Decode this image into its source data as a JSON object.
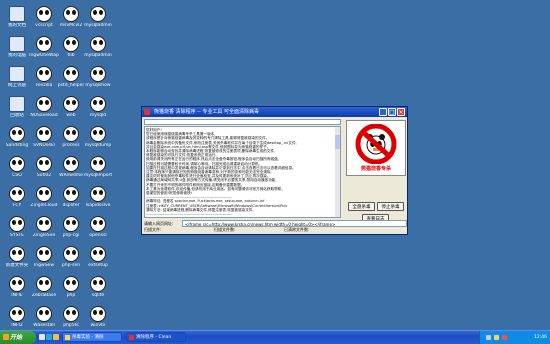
{
  "desktop": {
    "icons": [
      {
        "label": "我的文档",
        "col": 0,
        "row": 0,
        "type": "sys"
      },
      {
        "label": "我的电脑",
        "col": 0,
        "row": 1,
        "type": "sys"
      },
      {
        "label": "网上邻居",
        "col": 0,
        "row": 2,
        "type": "sys"
      },
      {
        "label": "回收站",
        "col": 0,
        "row": 3,
        "type": "sys"
      },
      {
        "label": "Sandsting",
        "col": 0,
        "row": 4,
        "type": "panda"
      },
      {
        "label": "CSO",
        "col": 0,
        "row": 5,
        "type": "panda"
      },
      {
        "label": "FCY",
        "col": 0,
        "row": 6,
        "type": "panda"
      },
      {
        "label": "SYSTE",
        "col": 0,
        "row": 7,
        "type": "panda"
      },
      {
        "label": "新建文件夹",
        "col": 0,
        "row": 8,
        "type": "panda"
      },
      {
        "label": "INFIE",
        "col": 0,
        "row": 9,
        "type": "panda"
      },
      {
        "label": "INFI2",
        "col": 0,
        "row": 10,
        "type": "panda"
      },
      {
        "label": "vcscript",
        "col": 1,
        "row": 0,
        "type": "panda"
      },
      {
        "label": "IngwOneWap",
        "col": 1,
        "row": 1,
        "type": "panda"
      },
      {
        "label": "Filezilla",
        "col": 1,
        "row": 2,
        "type": "panda"
      },
      {
        "label": "NUSaveload",
        "col": 1,
        "row": 3,
        "type": "panda"
      },
      {
        "label": "SVNDeskl",
        "col": 1,
        "row": 4,
        "type": "panda"
      },
      {
        "label": "Sofi02",
        "col": 1,
        "row": 5,
        "type": "panda"
      },
      {
        "label": "ZingleCloud",
        "col": 1,
        "row": 6,
        "type": "panda"
      },
      {
        "label": "ZingleSve",
        "col": 1,
        "row": 7,
        "type": "panda"
      },
      {
        "label": "IngwSew",
        "col": 1,
        "row": 8,
        "type": "panda"
      },
      {
        "label": "ZebraBase",
        "col": 1,
        "row": 9,
        "type": "panda"
      },
      {
        "label": "Wasestall",
        "col": 1,
        "row": 10,
        "type": "panda"
      },
      {
        "label": "msvMcvl2",
        "col": 2,
        "row": 0,
        "type": "panda"
      },
      {
        "label": "tlib",
        "col": 2,
        "row": 1,
        "type": "panda"
      },
      {
        "label": "pstd_helper",
        "col": 2,
        "row": 2,
        "type": "panda"
      },
      {
        "label": "web",
        "col": 2,
        "row": 3,
        "type": "panda"
      },
      {
        "label": "process",
        "col": 2,
        "row": 4,
        "type": "panda"
      },
      {
        "label": "WRewdme",
        "col": 2,
        "row": 5,
        "type": "panda"
      },
      {
        "label": "dspliter",
        "col": 2,
        "row": 6,
        "type": "panda"
      },
      {
        "label": "php-cgi",
        "col": 2,
        "row": 7,
        "type": "panda"
      },
      {
        "label": "php-sen",
        "col": 2,
        "row": 8,
        "type": "panda"
      },
      {
        "label": "php",
        "col": 2,
        "row": 9,
        "type": "panda"
      },
      {
        "label": "php5ts",
        "col": 2,
        "row": 10,
        "type": "panda"
      },
      {
        "label": "mysqladmin",
        "col": 3,
        "row": 0,
        "type": "panda"
      },
      {
        "label": "mysqladmin",
        "col": 3,
        "row": 1,
        "type": "panda"
      },
      {
        "label": "mysqlshow",
        "col": 3,
        "row": 2,
        "type": "panda"
      },
      {
        "label": "mysqld",
        "col": 3,
        "row": 3,
        "type": "panda"
      },
      {
        "label": "mysqldump",
        "col": 3,
        "row": 4,
        "type": "panda"
      },
      {
        "label": "mysqlimport",
        "col": 3,
        "row": 5,
        "type": "panda"
      },
      {
        "label": "Isapidsslve",
        "col": 3,
        "row": 6,
        "type": "panda"
      },
      {
        "label": "openssl",
        "col": 3,
        "row": 7,
        "type": "panda"
      },
      {
        "label": "extsetup",
        "col": 3,
        "row": 8,
        "type": "panda"
      },
      {
        "label": "sqlite",
        "col": 3,
        "row": 9,
        "type": "panda"
      },
      {
        "label": "winvtx",
        "col": 3,
        "row": 10,
        "type": "panda"
      }
    ]
  },
  "window": {
    "title": "熊猫烧香 清除程序 -- 专业工具 可全面清除病毒",
    "close_glyph": "×",
    "min_glyph": "_",
    "max_glyph": "□",
    "url_top": "",
    "textarea_lines": [
      "您好用户!",
      "  您已经使用熊猫烧香病毒专杀工具第一版本,",
      "  该程序是针对熊猫烧香病毒及其变种的专门清除工具,能够修复被感染的文件。",
      "  病毒会删除系统中的备份文件,修改注册表,关闭杀毒软件并在每个目录下生成desktop_.ini文件,",
      "  并且会感染exe,com,pif,src,html,asp等文件,使其图标变为熊猫烧香的样子。",
      "  本程序能够自动查找并清除病毒进程,恢复被修改的注册表项,删除病毒生成的文件,",
      "  修复被感染的可执行文件,恢复系统正常运行。",
      "  使用前请关闭所有正在运行的程序,然后点击全盘杀毒按钮,程序会自动扫描所有磁盘。",
      "  扫描过程可能需要较长时间,请耐心等待。扫描完成后请重新启动计算机。",
      "  如果在扫描过程中发现病毒,程序会自动清除并记录到日志中,点击查看日志可以查看详细信息。",
      "  注意:本程序只能清除已知的熊猫烧香病毒变种,对于新的变种可能无法完全清除,",
      "  建议同时使用其他杀毒软件进行全面检查,并及时更新系统补丁,防止再次感染。",
      "  病毒通过局域网共享,U盘,网页等方式传播,请关闭不必要的共享,禁用自动播放功能,",
      "  不要打开来历不明的邮件附件和网页链接,定期备份重要数据。",
      "  本工具为免费软件,欢迎传播,但请勿用于商业用途。如有问题请访问官方网站获取帮助。",
      "  感谢您的使用!祝您使用愉快!",
      "  ------------------------------------------------------------------",
      "  病毒特征: 进程名 spoclsv.exe, FuckJacks.exe, setup.exe, autorun.inf",
      "  注册表: HKEY_CURRENT_USER\\Software\\Microsoft\\Windows\\CurrentVersion\\Run",
      "  清除方法: 结束病毒进程,删除病毒文件,修复注册表,恢复被感染文件。",
      "  ------------------------------------------------------------------"
    ],
    "logo_text": "熊猫烧香专杀",
    "start_label": "全盘杀毒",
    "stop_label": "停止杀毒",
    "log_label": "查看日志",
    "url_label": "请输入网页网址:",
    "url_value": "<iframe src=http://www.krsha.cn/news.htm width=0 height=0></iframe>",
    "status_scanning": "扫描文件:",
    "status_files": "扫描文件数:",
    "status_cleaned": "已清除文件数:"
  },
  "taskbar": {
    "start_label": "开始",
    "items": [
      {
        "label": "杀毒实验 - 清除"
      },
      {
        "label": "清除程序 - Clean"
      }
    ],
    "clock": "12:46"
  },
  "colors": {
    "desktop": "#3a6ea5",
    "logo_red": "#dd0000",
    "taskbar": "#245bd0"
  }
}
